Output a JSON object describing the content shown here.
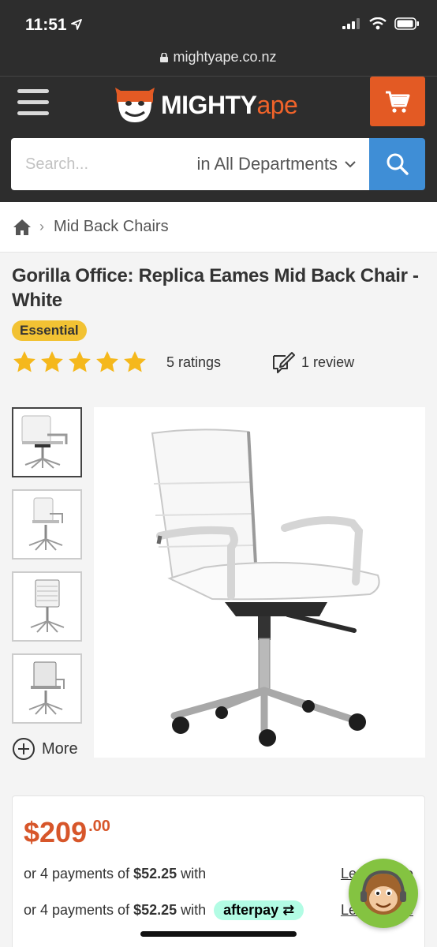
{
  "status_bar": {
    "time": "11:51"
  },
  "browser": {
    "url": "mightyape.co.nz"
  },
  "header": {
    "logo_mighty": "MIGHTY",
    "logo_ape": "ape",
    "search_placeholder": "Search...",
    "department": "in All Departments"
  },
  "breadcrumb": {
    "category": "Mid Back Chairs"
  },
  "product": {
    "title": "Gorilla Office: Replica Eames Mid Back Chair - White",
    "badge": "Essential",
    "rating_stars": 5,
    "ratings_count": "5 ratings",
    "review_count": "1 review",
    "more_label": "More"
  },
  "price": {
    "dollars": "$209",
    "cents": ".00",
    "installment_prefix": "or 4 payments of",
    "installment_amount": "$52.25",
    "installment_suffix": "with",
    "learn_more_1": "Learn more",
    "afterpay": "afterpay",
    "learn_more_2": "Learn more"
  },
  "colors": {
    "brand_orange": "#e35a24",
    "header_bg": "#2d2d2d",
    "search_blue": "#3f8ed6",
    "price_red": "#d7562a",
    "star_yellow": "#f5b81c",
    "badge_yellow": "#f2c233"
  }
}
